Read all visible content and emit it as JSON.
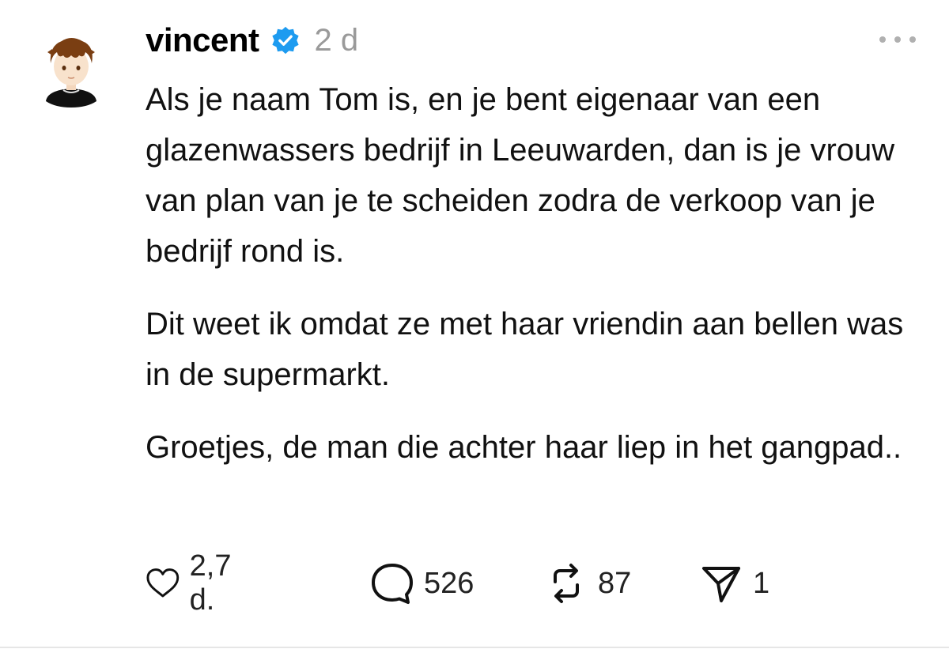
{
  "post": {
    "author": "vincent",
    "verified": true,
    "time": "2 d",
    "paragraphs": [
      "Als je naam Tom is, en je bent eigenaar van een glazenwassers bedrijf in Leeuwarden, dan is je vrouw van plan van je te scheiden zodra de verkoop van je bedrijf rond is.",
      "Dit weet ik omdat ze met haar vriendin aan bellen was in de supermarkt.",
      "Groetjes, de man die achter haar liep in het gangpad.."
    ]
  },
  "actions": {
    "like_count": "2,7 d.",
    "reply_count": "526",
    "repost_count": "87",
    "share_count": "1"
  },
  "icons": {
    "avatar": "avatar-cartoon",
    "verified": "verified-badge-icon",
    "more": "more-options-icon",
    "like": "heart-icon",
    "reply": "speech-bubble-icon",
    "repost": "repost-icon",
    "share": "send-icon"
  },
  "colors": {
    "verified_badge": "#1d9bf0",
    "meta_gray": "#9a9a9a",
    "text": "#111111"
  }
}
